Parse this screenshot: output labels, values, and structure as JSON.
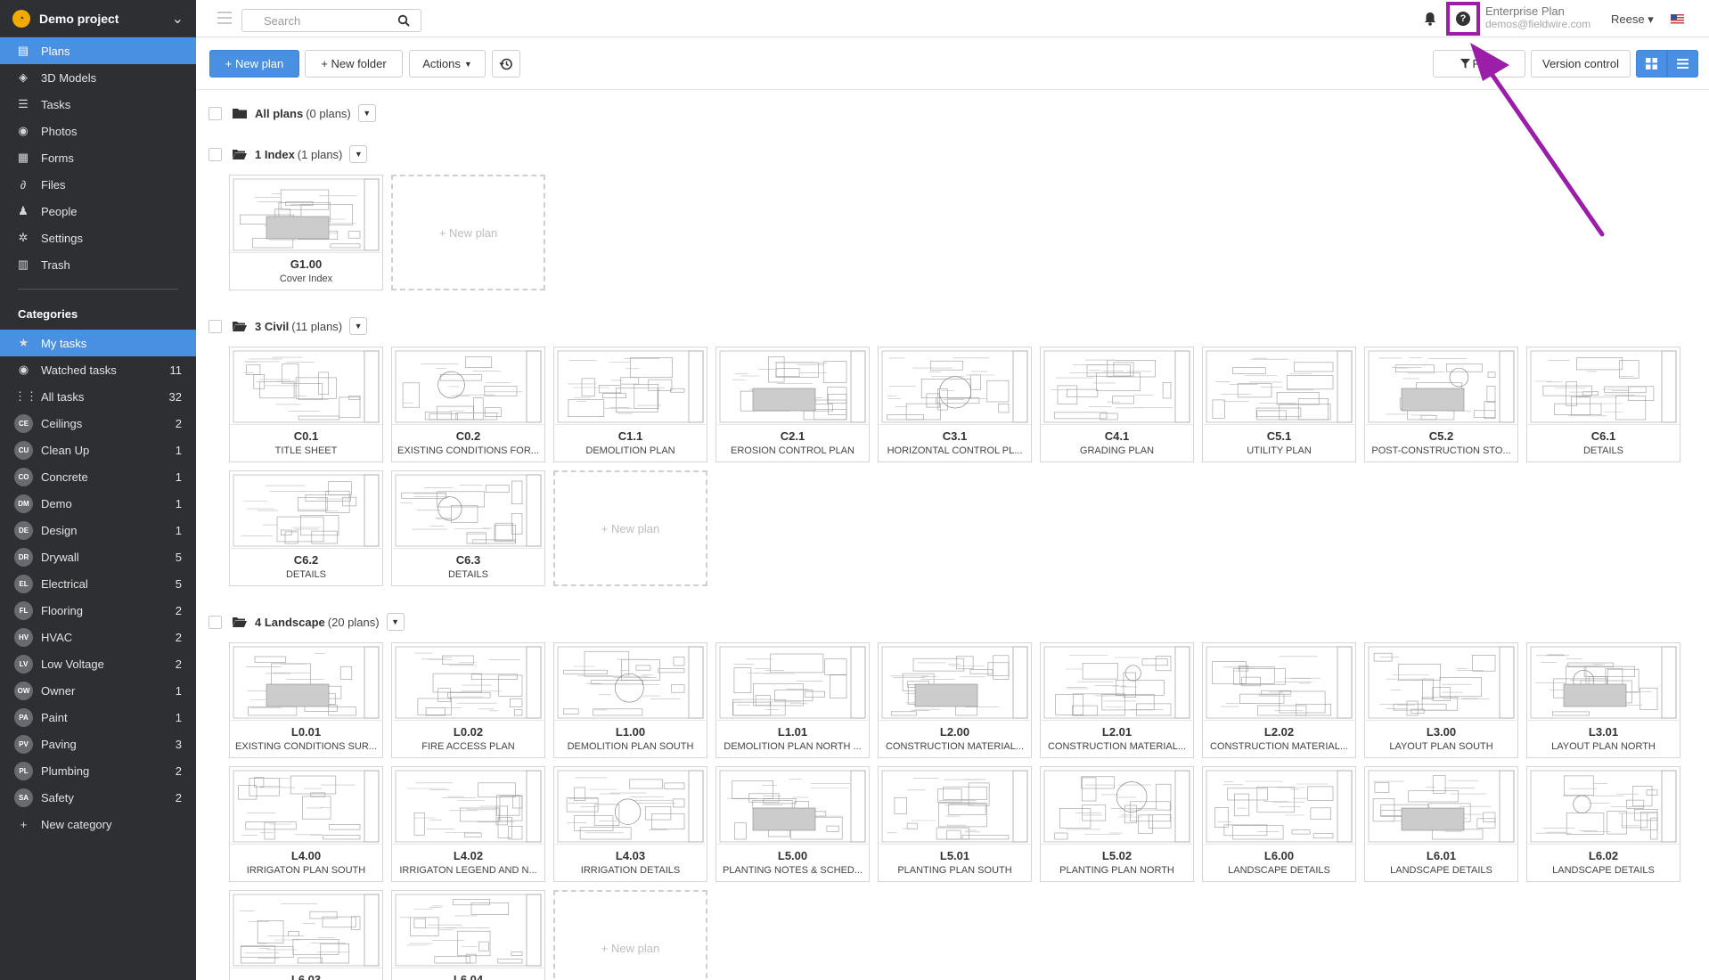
{
  "project": {
    "name": "Demo project"
  },
  "nav": [
    {
      "label": "Plans",
      "icon": "plans-icon",
      "glyph": "▤",
      "active": true
    },
    {
      "label": "3D Models",
      "icon": "cube-icon",
      "glyph": "◈"
    },
    {
      "label": "Tasks",
      "icon": "list-icon",
      "glyph": "☰"
    },
    {
      "label": "Photos",
      "icon": "camera-icon",
      "glyph": "◉"
    },
    {
      "label": "Forms",
      "icon": "clipboard-icon",
      "glyph": "▦"
    },
    {
      "label": "Files",
      "icon": "paperclip-icon",
      "glyph": "∂"
    },
    {
      "label": "People",
      "icon": "people-icon",
      "glyph": "♟"
    },
    {
      "label": "Settings",
      "icon": "gear-icon",
      "glyph": "✲"
    },
    {
      "label": "Trash",
      "icon": "trash-icon",
      "glyph": "▥"
    }
  ],
  "categories_title": "Categories",
  "categories": [
    {
      "label": "My tasks",
      "glyph": "★",
      "icon": "star-icon",
      "count": "",
      "active": true
    },
    {
      "label": "Watched tasks",
      "glyph": "◉",
      "icon": "eye-icon",
      "count": "11"
    },
    {
      "label": "All tasks",
      "glyph": "⋮⋮",
      "icon": "grid-icon",
      "count": "32"
    },
    {
      "label": "Ceilings",
      "badge": "CE",
      "count": "2"
    },
    {
      "label": "Clean Up",
      "badge": "CU",
      "count": "1"
    },
    {
      "label": "Concrete",
      "badge": "CO",
      "count": "1"
    },
    {
      "label": "Demo",
      "badge": "DM",
      "count": "1"
    },
    {
      "label": "Design",
      "badge": "DE",
      "count": "1"
    },
    {
      "label": "Drywall",
      "badge": "DR",
      "count": "5"
    },
    {
      "label": "Electrical",
      "badge": "EL",
      "count": "5"
    },
    {
      "label": "Flooring",
      "badge": "FL",
      "count": "2"
    },
    {
      "label": "HVAC",
      "badge": "HV",
      "count": "2"
    },
    {
      "label": "Low Voltage",
      "badge": "LV",
      "count": "2"
    },
    {
      "label": "Owner",
      "badge": "OW",
      "count": "1"
    },
    {
      "label": "Paint",
      "badge": "PA",
      "count": "1"
    },
    {
      "label": "Paving",
      "badge": "PV",
      "count": "3"
    },
    {
      "label": "Plumbing",
      "badge": "PL",
      "count": "2"
    },
    {
      "label": "Safety",
      "badge": "SA",
      "count": "2"
    },
    {
      "label": "New category",
      "glyph": "+",
      "icon": "plus-icon",
      "count": ""
    }
  ],
  "topbar": {
    "search_placeholder": "Search",
    "plan_name": "Enterprise Plan",
    "email": "demos@fieldwire.com",
    "user": "Reese ▾"
  },
  "actions": {
    "new_plan": "+ New plan",
    "new_folder": "+ New folder",
    "actions": "Actions",
    "filter": "Filter",
    "version_control": "Version control"
  },
  "folders": [
    {
      "name": "All plans",
      "count": "(0 plans)",
      "open": false,
      "plans": []
    },
    {
      "name": "1 Index",
      "count": "(1 plans)",
      "open": true,
      "plans": [
        {
          "code": "G1.00",
          "title": "Cover Index"
        }
      ]
    },
    {
      "name": "3 Civil",
      "count": "(11 plans)",
      "open": true,
      "plans": [
        {
          "code": "C0.1",
          "title": "TITLE SHEET"
        },
        {
          "code": "C0.2",
          "title": "EXISTING CONDITIONS FOR..."
        },
        {
          "code": "C1.1",
          "title": "DEMOLITION PLAN"
        },
        {
          "code": "C2.1",
          "title": "EROSION CONTROL PLAN"
        },
        {
          "code": "C3.1",
          "title": "HORIZONTAL CONTROL PL..."
        },
        {
          "code": "C4.1",
          "title": "GRADING PLAN"
        },
        {
          "code": "C5.1",
          "title": "UTILITY PLAN"
        },
        {
          "code": "C5.2",
          "title": "POST-CONSTRUCTION STO..."
        },
        {
          "code": "C6.1",
          "title": "DETAILS"
        },
        {
          "code": "C6.2",
          "title": "DETAILS"
        },
        {
          "code": "C6.3",
          "title": "DETAILS"
        }
      ]
    },
    {
      "name": "4 Landscape",
      "count": "(20 plans)",
      "open": true,
      "plans": [
        {
          "code": "L0.01",
          "title": "EXISTING CONDITIONS SUR..."
        },
        {
          "code": "L0.02",
          "title": "FIRE ACCESS PLAN"
        },
        {
          "code": "L1.00",
          "title": "DEMOLITION PLAN SOUTH"
        },
        {
          "code": "L1.01",
          "title": "DEMOLITION PLAN NORTH ..."
        },
        {
          "code": "L2.00",
          "title": "CONSTRUCTION MATERIAL..."
        },
        {
          "code": "L2.01",
          "title": "CONSTRUCTION MATERIAL..."
        },
        {
          "code": "L2.02",
          "title": "CONSTRUCTION MATERIAL..."
        },
        {
          "code": "L3.00",
          "title": "LAYOUT PLAN SOUTH"
        },
        {
          "code": "L3.01",
          "title": "LAYOUT PLAN NORTH"
        },
        {
          "code": "L4.00",
          "title": "IRRIGATON PLAN SOUTH"
        },
        {
          "code": "L4.02",
          "title": "IRRIGATON LEGEND AND N..."
        },
        {
          "code": "L4.03",
          "title": "IRRIGATION DETAILS"
        },
        {
          "code": "L5.00",
          "title": "PLANTING NOTES & SCHED..."
        },
        {
          "code": "L5.01",
          "title": "PLANTING PLAN SOUTH"
        },
        {
          "code": "L5.02",
          "title": "PLANTING PLAN NORTH"
        },
        {
          "code": "L6.00",
          "title": "LANDSCAPE DETAILS"
        },
        {
          "code": "L6.01",
          "title": "LANDSCAPE DETAILS"
        },
        {
          "code": "L6.02",
          "title": "LANDSCAPE DETAILS"
        },
        {
          "code": "L6.03",
          "title": ""
        },
        {
          "code": "L6.04",
          "title": ""
        }
      ]
    }
  ],
  "new_plan_card": "+ New plan",
  "colors": {
    "accent": "#4a90e2",
    "sidebar": "#2d2f33",
    "highlight": "#9b1ea8"
  }
}
